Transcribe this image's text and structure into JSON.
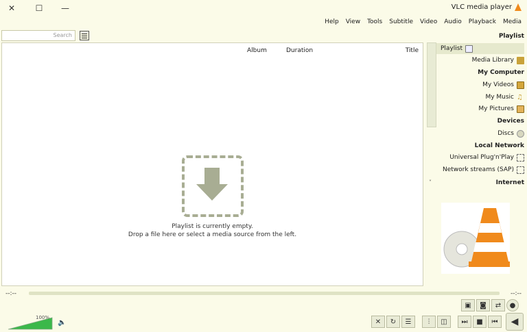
{
  "window": {
    "title": "VLC media player",
    "controls": {
      "close": "✕",
      "maximize": "☐",
      "minimize": "—"
    }
  },
  "menu": [
    "Media",
    "Playback",
    "Audio",
    "Video",
    "Subtitle",
    "Tools",
    "View",
    "Help"
  ],
  "search": {
    "placeholder": "Search"
  },
  "playlist": {
    "columns": {
      "title": "Title",
      "duration": "Duration",
      "album": "Album"
    },
    "empty_line1": "Playlist is currently empty.",
    "empty_line2": "Drop a file here or select a media source from the left."
  },
  "sidebar": {
    "sections": {
      "playlist": "Playlist",
      "my_computer": "My Computer",
      "devices": "Devices",
      "local_network": "Local Network",
      "internet": "Internet"
    },
    "items": {
      "playlist": "Playlist",
      "media_library": "Media Library",
      "my_videos": "My Videos",
      "my_music": "My Music",
      "my_pictures": "My Pictures",
      "discs": "Discs",
      "upnp": "Universal Plug'n'Play",
      "sap": "Network streams (SAP)"
    }
  },
  "seek": {
    "elapsed": "--:--",
    "total": "--:--"
  },
  "volume": {
    "label": "100%",
    "level": 1.0
  },
  "colors": {
    "accent": "#3bb84a",
    "vlc_orange": "#f08a1c"
  }
}
